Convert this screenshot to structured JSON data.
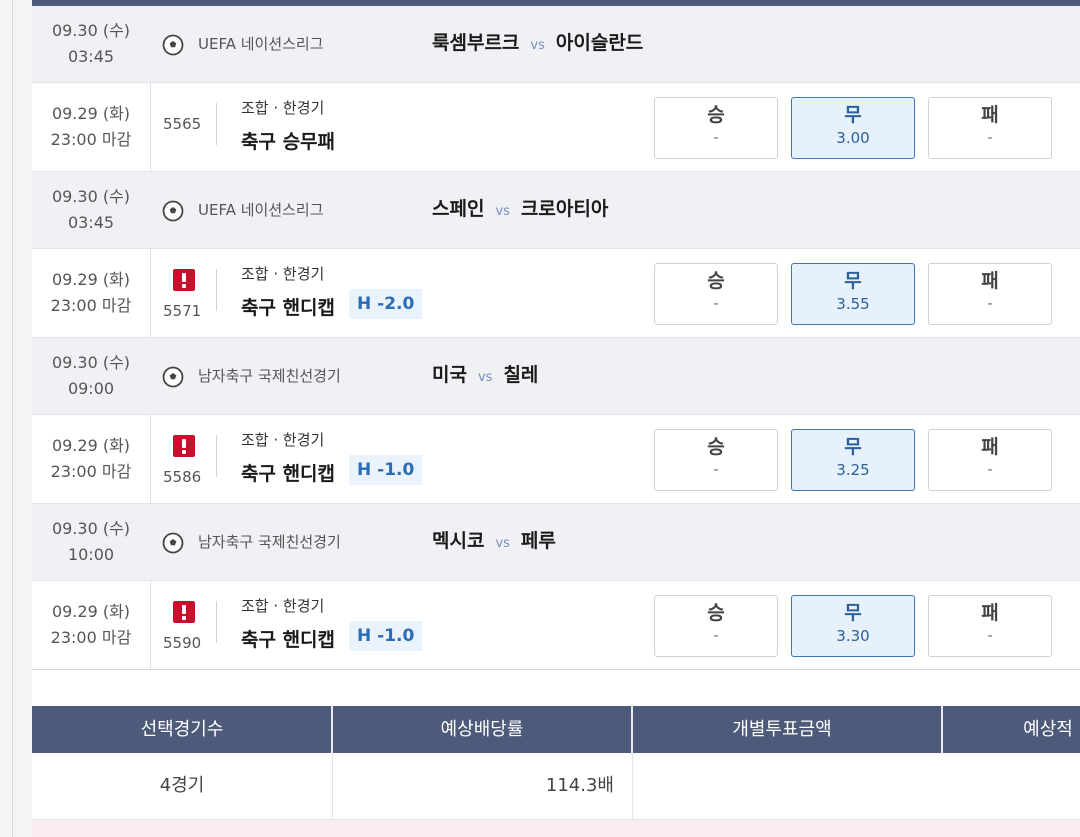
{
  "matches": [
    {
      "date": "09.30 (수)",
      "time": "03:45",
      "league": "UEFA 네이션스리그",
      "home": "룩셈부르크",
      "vs": "vs",
      "away": "아이슬란드",
      "bet": {
        "date": "09.29 (화)",
        "deadline": "23:00 마감",
        "game_no": "5565",
        "has_alert": false,
        "type": "조합 · 한경기",
        "name": "축구 승무패",
        "handicap": "",
        "odds": [
          {
            "label": "승",
            "value": "-",
            "selected": false
          },
          {
            "label": "무",
            "value": "3.00",
            "selected": true
          },
          {
            "label": "패",
            "value": "-",
            "selected": false
          }
        ]
      }
    },
    {
      "date": "09.30 (수)",
      "time": "03:45",
      "league": "UEFA 네이션스리그",
      "home": "스페인",
      "vs": "vs",
      "away": "크로아티아",
      "bet": {
        "date": "09.29 (화)",
        "deadline": "23:00 마감",
        "game_no": "5571",
        "has_alert": true,
        "type": "조합 · 한경기",
        "name": "축구 핸디캡",
        "handicap": "H -2.0",
        "odds": [
          {
            "label": "승",
            "value": "-",
            "selected": false
          },
          {
            "label": "무",
            "value": "3.55",
            "selected": true
          },
          {
            "label": "패",
            "value": "-",
            "selected": false
          }
        ]
      }
    },
    {
      "date": "09.30 (수)",
      "time": "09:00",
      "league": "남자축구 국제친선경기",
      "home": "미국",
      "vs": "vs",
      "away": "칠레",
      "bet": {
        "date": "09.29 (화)",
        "deadline": "23:00 마감",
        "game_no": "5586",
        "has_alert": true,
        "type": "조합 · 한경기",
        "name": "축구 핸디캡",
        "handicap": "H -1.0",
        "odds": [
          {
            "label": "승",
            "value": "-",
            "selected": false
          },
          {
            "label": "무",
            "value": "3.25",
            "selected": true
          },
          {
            "label": "패",
            "value": "-",
            "selected": false
          }
        ]
      }
    },
    {
      "date": "09.30 (수)",
      "time": "10:00",
      "league": "남자축구 국제친선경기",
      "home": "멕시코",
      "vs": "vs",
      "away": "페루",
      "bet": {
        "date": "09.29 (화)",
        "deadline": "23:00 마감",
        "game_no": "5590",
        "has_alert": true,
        "type": "조합 · 한경기",
        "name": "축구 핸디캡",
        "handicap": "H -1.0",
        "odds": [
          {
            "label": "승",
            "value": "-",
            "selected": false
          },
          {
            "label": "무",
            "value": "3.30",
            "selected": true
          },
          {
            "label": "패",
            "value": "-",
            "selected": false
          }
        ]
      }
    }
  ],
  "summary": {
    "headers": [
      "선택경기수",
      "예상배당률",
      "개별투표금액",
      "예상적"
    ],
    "values": [
      "4경기",
      "114.3배",
      "",
      ""
    ]
  },
  "colors": {
    "header_bg": "#4d5a7a",
    "match_row_bg": "#f0f1f4",
    "selected_bg": "#e6f1fb",
    "selected_border": "#3a76b8",
    "handicap_text": "#2a6db5",
    "alert": "#c8102e",
    "vs_text": "#7a8fbf"
  },
  "icons": {
    "league": "soccer-ball-icon",
    "alert": "exclamation-alert-icon"
  }
}
